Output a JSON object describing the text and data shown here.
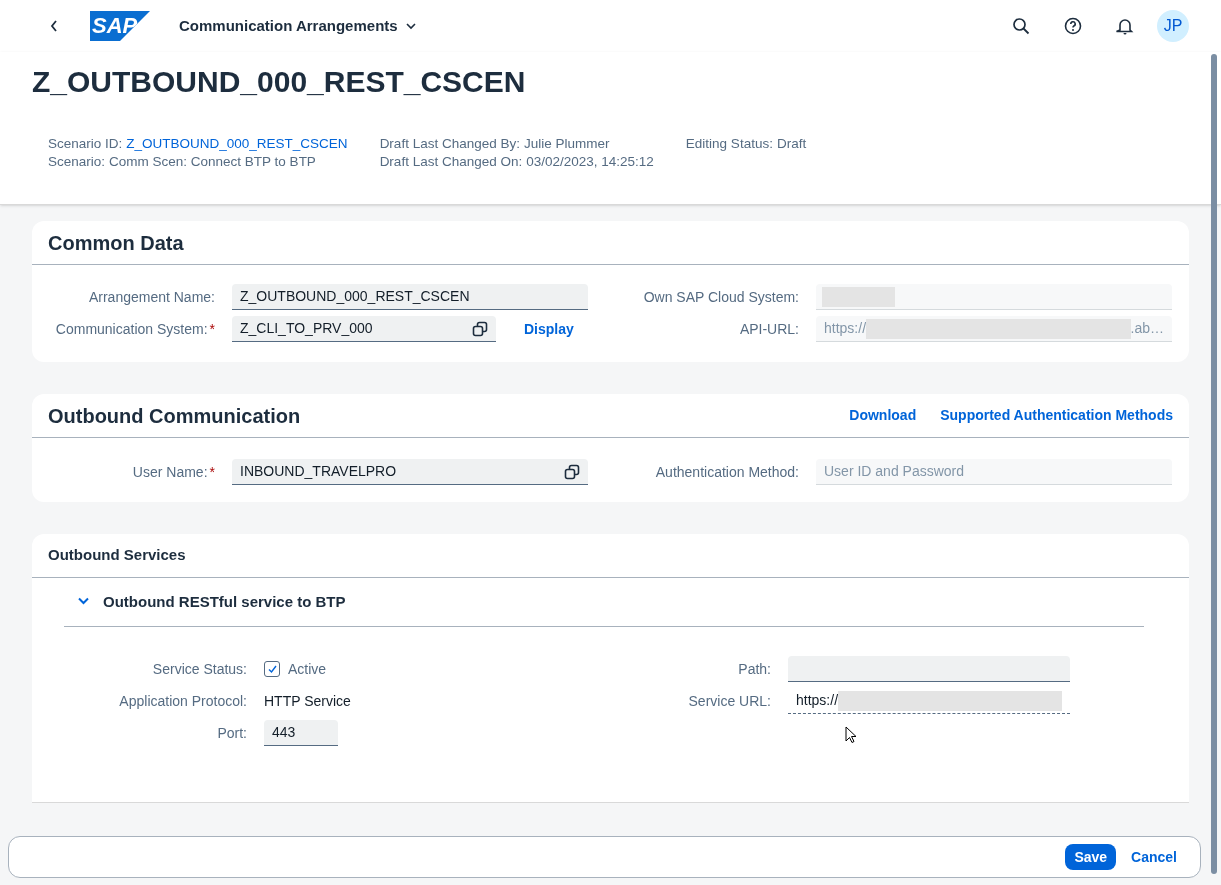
{
  "shell": {
    "logo": "SAP",
    "title": "Communication Arrangements",
    "avatar": "JP"
  },
  "header": {
    "title": "Z_OUTBOUND_000_REST_CSCEN",
    "columns": [
      [
        {
          "label": "Scenario ID:",
          "value": "Z_OUTBOUND_000_REST_CSCEN",
          "kind": "link"
        },
        {
          "label": "Scenario:",
          "value": "Comm Scen: Connect BTP to BTP",
          "kind": "text"
        }
      ],
      [
        {
          "label": "Draft Last Changed By:",
          "value": "Julie Plummer",
          "kind": "text"
        },
        {
          "label": "Draft Last Changed On:",
          "value": "03/02/2023, 14:25:12",
          "kind": "text"
        }
      ],
      [
        {
          "label": "Editing Status:",
          "value": "Draft",
          "kind": "text"
        }
      ]
    ]
  },
  "common_data": {
    "title": "Common Data",
    "left": [
      {
        "label": "Arrangement Name:",
        "value": "Z_OUTBOUND_000_REST_CSCEN",
        "kind": "input",
        "required": false,
        "value_help": false
      },
      {
        "label": "Communication System:",
        "value": "Z_CLI_TO_PRV_000",
        "kind": "input",
        "required": true,
        "value_help": true,
        "link": "Display"
      }
    ],
    "right": [
      {
        "label": "Own SAP Cloud System:",
        "kind": "readonly",
        "masked": true
      },
      {
        "label": "API-URL:",
        "value": "https://",
        "suffix": ".ab…",
        "kind": "readonly",
        "masked": true
      }
    ]
  },
  "outbound": {
    "title": "Outbound Communication",
    "links": [
      "Download",
      "Supported Authentication Methods"
    ],
    "left": [
      {
        "label": "User Name:",
        "value": "INBOUND_TRAVELPRO",
        "kind": "input",
        "required": true,
        "value_help": true
      }
    ],
    "right": [
      {
        "label": "Authentication Method:",
        "value": "User ID and Password",
        "kind": "readonly",
        "masked": false
      }
    ]
  },
  "services": {
    "title": "Outbound Services",
    "panel": {
      "title": "Outbound RESTful service to BTP",
      "expanded": true,
      "left": [
        {
          "label": "Service Status:",
          "value": "Active",
          "kind": "checkbox",
          "checked": true
        },
        {
          "label": "Application Protocol:",
          "value": "HTTP Service",
          "kind": "text"
        },
        {
          "label": "Port:",
          "value": "443",
          "kind": "input",
          "required": false,
          "value_help": false
        }
      ],
      "right": [
        {
          "label": "Path:",
          "kind": "input",
          "required": false,
          "value_help": false
        },
        {
          "label": "Service URL:",
          "value": "https://",
          "kind": "dashed",
          "masked": true
        }
      ]
    }
  },
  "required_mark": "*",
  "footer": {
    "buttons": [
      "Save",
      "Cancel"
    ]
  }
}
